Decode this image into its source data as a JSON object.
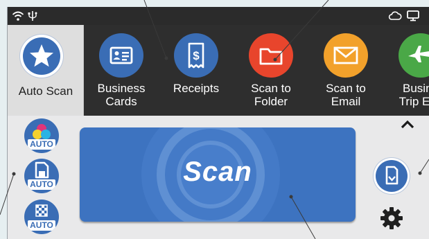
{
  "status_bar": {
    "icons": [
      "wifi-icon",
      "usb-icon",
      "cloud-icon",
      "monitor-icon"
    ]
  },
  "auto_scan": {
    "label": "Auto Scan",
    "icon": "star-icon"
  },
  "profiles": [
    {
      "label": "Business\nCards",
      "icon": "business-card-icon",
      "color": "#3a6db5"
    },
    {
      "label": "Receipts",
      "icon": "receipt-icon",
      "color": "#3a6db5"
    },
    {
      "label": "Scan to\nFolder",
      "icon": "folder-icon",
      "color": "#e8452c"
    },
    {
      "label": "Scan to\nEmail",
      "icon": "envelope-icon",
      "color": "#f2a12b"
    },
    {
      "label": "Busine\nTrip Exp",
      "icon": "airplane-icon",
      "color": "#4aa847"
    }
  ],
  "scan_options": [
    {
      "label": "AUTO",
      "icon": "color-mode-icon"
    },
    {
      "label": "AUTO",
      "icon": "paper-size-icon"
    },
    {
      "label": "AUTO",
      "icon": "resolution-icon"
    }
  ],
  "scan_button": {
    "label": "Scan"
  },
  "right_controls": {
    "collapse_icon": "chevron-up-icon",
    "document_icon": "document-icon",
    "settings_icon": "gear-icon"
  },
  "colors": {
    "accent": "#3a6db5",
    "dark_bar": "#2e2e2e",
    "scan_button": "#3d73c0"
  }
}
